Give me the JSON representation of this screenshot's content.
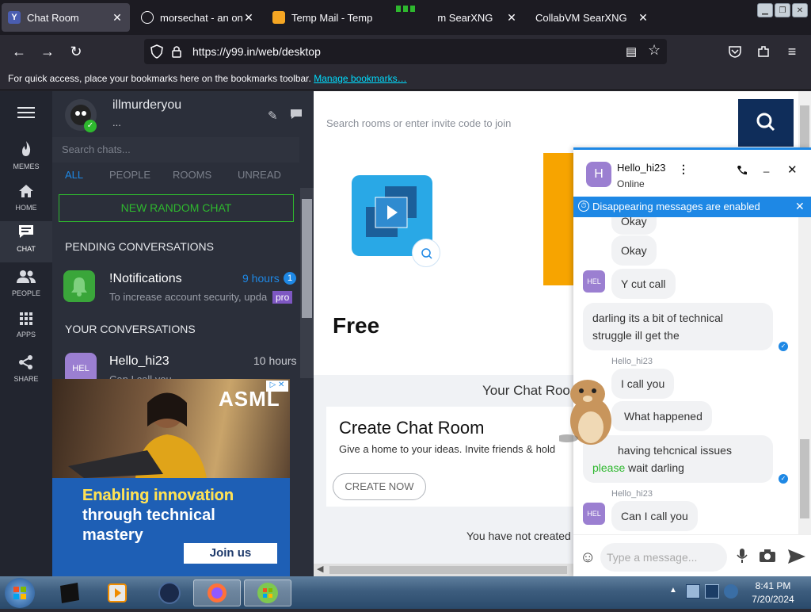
{
  "browser": {
    "tabs": [
      {
        "label": "Chat Room",
        "icon": "y99-icon",
        "active": true
      },
      {
        "label": "morsechat - an onlin",
        "icon": "globe-icon",
        "active": false
      },
      {
        "label": "Temp Mail - Temp",
        "icon": "tempmail-icon",
        "active": false
      },
      {
        "label": "CollabVM SearXNG",
        "icon": "",
        "active": false
      }
    ],
    "tab_overlap_text": "m SearXNG",
    "close_glyph": "✕",
    "url": "https://y99.in/web/desktop",
    "bookmarks_text": "For quick access, place your bookmarks here on the bookmarks toolbar.",
    "bookmarks_link": "Manage bookmarks…"
  },
  "rail": [
    {
      "label": "MEMES",
      "icon": "flame-icon",
      "glyph": "🔥"
    },
    {
      "label": "HOME",
      "icon": "home-icon",
      "glyph": "⌂"
    },
    {
      "label": "CHAT",
      "icon": "chat-icon",
      "glyph": "▤"
    },
    {
      "label": "PEOPLE",
      "icon": "people-icon",
      "glyph": "👥"
    },
    {
      "label": "APPS",
      "icon": "apps-icon",
      "glyph": "⠿"
    },
    {
      "label": "SHARE",
      "icon": "share-icon",
      "glyph": "⋖"
    }
  ],
  "profile": {
    "username": "illmurderyou",
    "status": "..."
  },
  "chat_list": {
    "search_placeholder": "Search chats...",
    "filters": [
      "ALL",
      "PEOPLE",
      "ROOMS",
      "UNREAD"
    ],
    "new_random_chat": "NEW RANDOM CHAT",
    "pending_header": "PENDING CONVERSATIONS",
    "your_header": "YOUR CONVERSATIONS",
    "pending": [
      {
        "name": "!Notifications",
        "time": "9 hours",
        "badge": "1",
        "preview": "To increase account security, upda",
        "tag": "pro"
      }
    ],
    "conversations": [
      {
        "name": "Hello_hi23",
        "time": "10 hours",
        "avatar": "HEL",
        "preview": "Can I call you"
      }
    ]
  },
  "ad": {
    "brand": "ASML",
    "headline": "Enabling innovation through technical mastery",
    "cta": "Join us"
  },
  "main": {
    "search_placeholder": "Search rooms or enter invite code to join",
    "free_label": "Free",
    "your_chat_rooms": "Your Chat Roo",
    "create_title": "Create Chat Room",
    "create_desc": "Give a home to your ideas. Invite friends & hold",
    "create_button": "CREATE NOW",
    "empty_text": "You have not created"
  },
  "chat_window": {
    "contact": "Hello_hi23",
    "avatar_letter": "H",
    "status": "Online",
    "banner": "Disappearing messages are enabled",
    "messages": [
      {
        "text": "Okay",
        "sender": "",
        "mine": false
      },
      {
        "text": "Okay",
        "sender": "",
        "mine": false
      },
      {
        "text": "Y cut call",
        "sender": "",
        "mine": false,
        "avatar": "HEL"
      },
      {
        "text": "darling its a bit of technical struggle ill get the",
        "sender": "",
        "mine": true
      },
      {
        "text": "I call you",
        "sender": "Hello_hi23",
        "mine": false
      },
      {
        "text": "What happened",
        "sender": "",
        "mine": false
      },
      {
        "text": "having tehcnical issues",
        "highlight": "please",
        "text2": "wait darling",
        "sender": "",
        "mine": true
      },
      {
        "text": "Can I call you",
        "sender": "Hello_hi23",
        "mine": false,
        "avatar": "HEL"
      }
    ],
    "input_placeholder": "Type a message..."
  },
  "taskbar": {
    "time": "8:41 PM",
    "date": "7/20/2024"
  },
  "colors": {
    "accent_blue": "#1e88e5",
    "navy_search": "#0f2d5a",
    "green": "#2eb82e",
    "rail_bg": "#22252f",
    "panel_bg": "#2b2f3a"
  }
}
